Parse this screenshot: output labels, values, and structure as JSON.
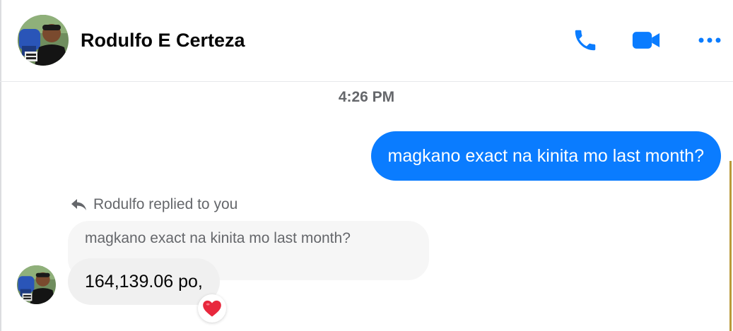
{
  "header": {
    "contact_name": "Rodulfo E Certeza",
    "actions": [
      {
        "name": "phone-icon"
      },
      {
        "name": "video-camera-icon"
      },
      {
        "name": "more-options-icon"
      }
    ]
  },
  "conversation": {
    "timestamp": "4:26 PM",
    "sent_message": "magkano exact na kinita mo last month?",
    "reply_label": "Rodulfo replied to you",
    "quoted_message": "magkano exact na kinita mo last month?",
    "received_message": "164,139.06 po,",
    "reaction": "heart-emoji"
  },
  "colors": {
    "accent": "#0a7cff",
    "bubble_received": "#f0f0f0",
    "bubble_quoted": "#f6f6f6",
    "muted_text": "#65676b",
    "reaction_heart": "#e8283d"
  }
}
